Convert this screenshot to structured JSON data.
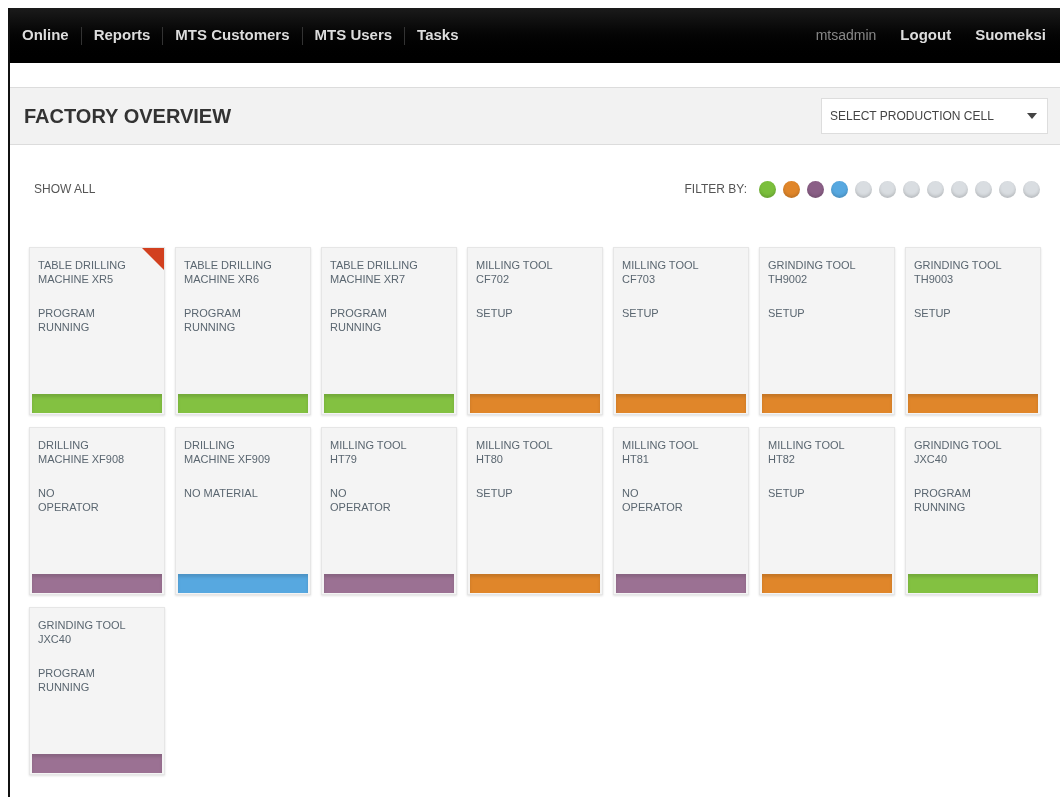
{
  "nav": {
    "items": [
      "Online",
      "Reports",
      "MTS Customers",
      "MTS Users",
      "Tasks"
    ],
    "user": "mtsadmin",
    "links": [
      "Logout",
      "Suomeksi"
    ]
  },
  "header": {
    "title": "FACTORY OVERVIEW",
    "select": "SELECT PRODUCTION CELL"
  },
  "toolbar": {
    "show_all": "SHOW ALL",
    "filter_label": "FILTER BY:",
    "filters": [
      {
        "color": "#7bbf3c"
      },
      {
        "color": "#e0862a"
      },
      {
        "color": "#8a5f86"
      },
      {
        "color": "#57a8e0"
      },
      {
        "color": "#d9dde1"
      },
      {
        "color": "#d9dde1"
      },
      {
        "color": "#d9dde1"
      },
      {
        "color": "#d9dde1"
      },
      {
        "color": "#d9dde1"
      },
      {
        "color": "#d9dde1"
      },
      {
        "color": "#d9dde1"
      },
      {
        "color": "#d9dde1"
      }
    ]
  },
  "machines": [
    {
      "name": "TABLE DRILLING MACHINE XR5",
      "status": "PROGRAM RUNNING",
      "color": "#83c141",
      "flagged": true
    },
    {
      "name": "TABLE DRILLING MACHINE XR6",
      "status": "PROGRAM RUNNING",
      "color": "#83c141",
      "flagged": false
    },
    {
      "name": "TABLE DRILLING MACHINE XR7",
      "status": "PROGRAM RUNNING",
      "color": "#83c141",
      "flagged": false
    },
    {
      "name": "MILLING TOOL CF702",
      "status": "SETUP",
      "color": "#e0862a",
      "flagged": false
    },
    {
      "name": "MILLING TOOL CF703",
      "status": "SETUP",
      "color": "#e0862a",
      "flagged": false
    },
    {
      "name": "GRINDING TOOL TH9002",
      "status": "SETUP",
      "color": "#e0862a",
      "flagged": false
    },
    {
      "name": "GRINDING TOOL TH9003",
      "status": "SETUP",
      "color": "#e0862a",
      "flagged": false
    },
    {
      "name": "DRILLING MACHINE XF908",
      "status": "NO OPERATOR",
      "color": "#9b7193",
      "flagged": false
    },
    {
      "name": "DRILLING MACHINE XF909",
      "status": "NO MATERIAL",
      "color": "#57a8e0",
      "flagged": false
    },
    {
      "name": "MILLING TOOL HT79",
      "status": "NO OPERATOR",
      "color": "#9b7193",
      "flagged": false
    },
    {
      "name": "MILLING TOOL HT80",
      "status": "SETUP",
      "color": "#e0862a",
      "flagged": false
    },
    {
      "name": "MILLING TOOL HT81",
      "status": "NO OPERATOR",
      "color": "#9b7193",
      "flagged": false
    },
    {
      "name": "MILLING TOOL HT82",
      "status": "SETUP",
      "color": "#e0862a",
      "flagged": false
    },
    {
      "name": "GRINDING TOOL JXC40",
      "status": "PROGRAM RUNNING",
      "color": "#83c141",
      "flagged": false
    },
    {
      "name": "GRINDING TOOL JXC40",
      "status": "PROGRAM RUNNING",
      "color": "#9b7193",
      "flagged": false
    }
  ]
}
